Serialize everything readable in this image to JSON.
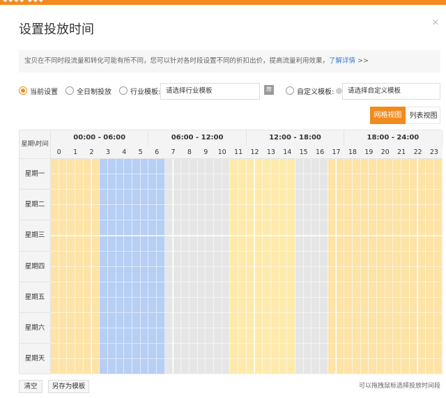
{
  "topbar": {
    "text": "◆◆◆◆ ◆◆◆"
  },
  "dialog": {
    "title": "设置投放时间",
    "close": "×"
  },
  "notice": {
    "text": "宝贝在不同时段流量和转化可能有所不同，您可以针对各时段设置不同的折扣出价，提高流量利用效果，",
    "link": "了解详情",
    "arrows": " >>"
  },
  "options": {
    "current": "当前设置",
    "all_day": "全日制投放",
    "industry": "行业模板:",
    "industry_placeholder": "请选择行业模板",
    "industry_btn": "荐",
    "custom": "自定义模板:",
    "custom_placeholder": "请选择自定义模板"
  },
  "views": {
    "grid": "网格视图",
    "list": "列表视图"
  },
  "grid": {
    "corner": "星期\\时间",
    "ranges": [
      "00:00 - 06:00",
      "06:00 - 12:00",
      "12:00 - 18:00",
      "18:00 - 24:00"
    ],
    "hours": [
      "0",
      "1",
      "2",
      "3",
      "4",
      "5",
      "6",
      "7",
      "8",
      "9",
      "10",
      "11",
      "12",
      "13",
      "14",
      "15",
      "16",
      "17",
      "18",
      "19",
      "20",
      "21",
      "22",
      "23"
    ],
    "days": [
      "星期一",
      "星期二",
      "星期三",
      "星期四",
      "星期五",
      "星期六",
      "星期天"
    ],
    "hour_states": [
      "orange",
      "orange",
      "orange",
      "blue",
      "blue",
      "blue",
      "blue",
      "gray",
      "gray",
      "gray",
      "gray",
      "yellow",
      "yellow",
      "yellow",
      "yellow",
      "gray",
      "gray",
      "orange",
      "orange",
      "orange",
      "orange",
      "orange",
      "orange",
      "orange"
    ],
    "colors": {
      "orange": "#fde3a6",
      "blue": "#b7cff4",
      "gray": "#e6e6e6",
      "yellow": "#feeaaa"
    }
  },
  "footer": {
    "clear": "清空",
    "save_template": "另存为模板",
    "hint": "可以拖拽鼠标选择投放时间段"
  }
}
